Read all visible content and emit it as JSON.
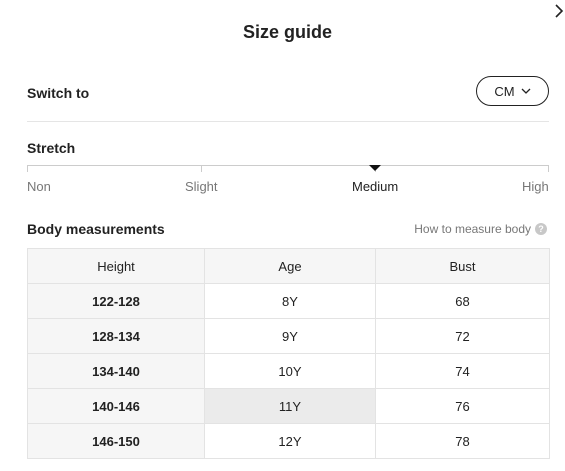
{
  "dialog": {
    "title": "Size guide"
  },
  "switch": {
    "label": "Switch to",
    "unit": "CM"
  },
  "stretch": {
    "label": "Stretch",
    "levels": [
      "Non",
      "Slight",
      "Medium",
      "High"
    ],
    "selected": "Medium"
  },
  "measurements": {
    "label": "Body measurements",
    "how_to_measure": "How to measure body",
    "help_glyph": "?",
    "columns": [
      "Height",
      "Age",
      "Bust"
    ],
    "rows": [
      [
        "122-128",
        "8Y",
        "68"
      ],
      [
        "128-134",
        "9Y",
        "72"
      ],
      [
        "134-140",
        "10Y",
        "74"
      ],
      [
        "140-146",
        "11Y",
        "76"
      ],
      [
        "146-150",
        "12Y",
        "78"
      ]
    ],
    "highlighted_cell": {
      "row": 3,
      "col": 1
    }
  },
  "icons": {
    "close": "chevron-right-icon",
    "dropdown": "chevron-down-icon",
    "help": "question-circle-icon"
  },
  "colors": {
    "text": "#222222",
    "muted": "#777777",
    "header_bg": "#f6f6f6",
    "highlight_bg": "#ebebeb",
    "border": "#e3e3e3"
  }
}
